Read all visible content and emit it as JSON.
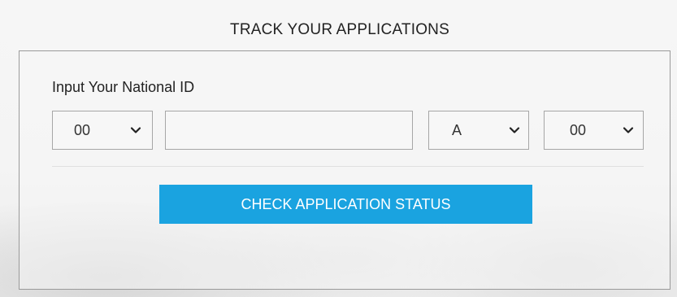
{
  "header": {
    "title": "TRACK YOUR APPLICATIONS"
  },
  "form": {
    "label": "Input Your National ID",
    "region_select": {
      "value": "00",
      "icon": "chevron-down-icon"
    },
    "id_number_input": {
      "value": "",
      "placeholder": ""
    },
    "letter_select": {
      "value": "A",
      "icon": "chevron-down-icon"
    },
    "suffix_select": {
      "value": "00",
      "icon": "chevron-down-icon"
    },
    "submit_label": "CHECK APPLICATION STATUS"
  },
  "colors": {
    "accent": "#1aa3e0",
    "border": "#a6a6a6",
    "text": "#222222"
  }
}
